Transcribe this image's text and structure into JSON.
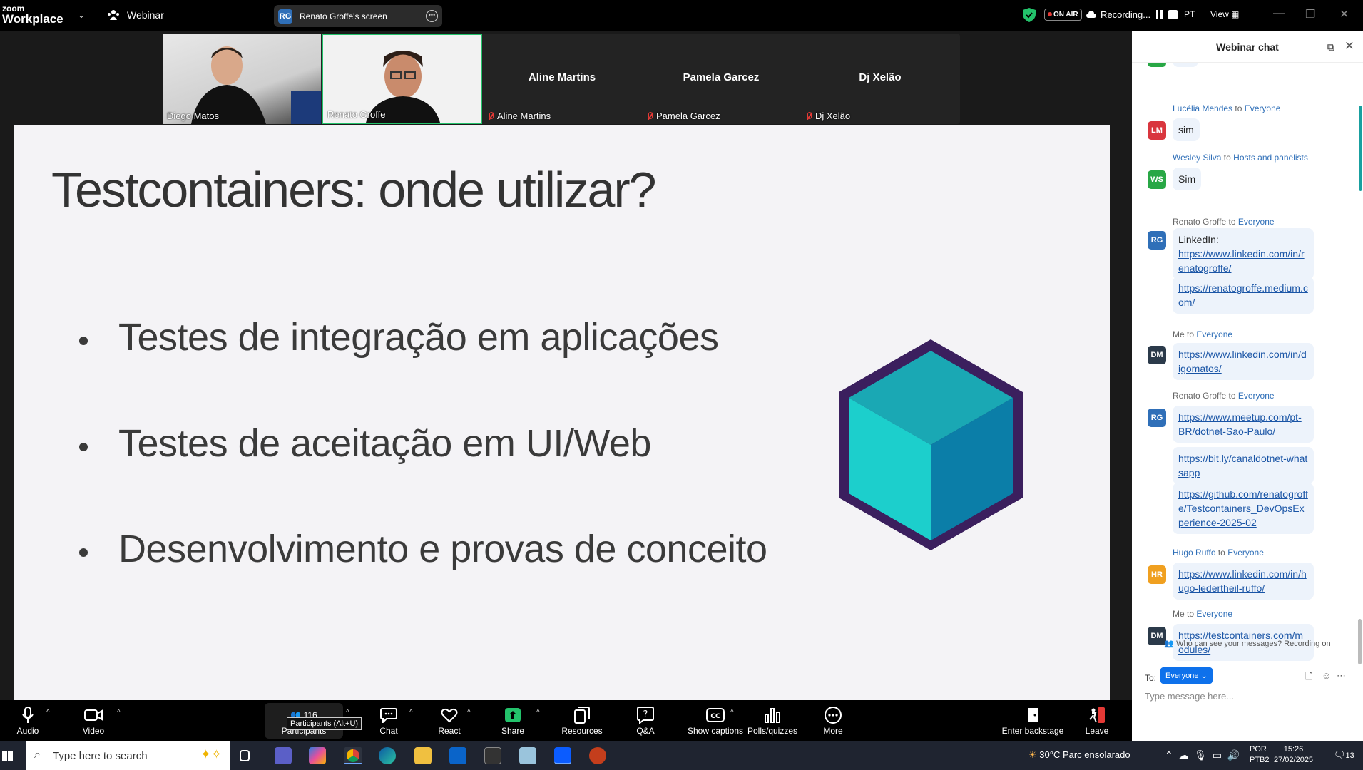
{
  "app": {
    "logo_small": "zoom",
    "logo_big": "Workplace",
    "mode": "Webinar"
  },
  "screen_share": {
    "badge": "RG",
    "label": "Renato Groffe's screen"
  },
  "top_right": {
    "onair": "ON AIR",
    "recording": "Recording...",
    "lang": "PT",
    "view": "View"
  },
  "participants": [
    {
      "name": "Diego Matos"
    },
    {
      "name": "Renato Groffe"
    },
    {
      "name": "Aline Martins"
    },
    {
      "name": "Pamela Garcez"
    },
    {
      "name": "Dj Xelão"
    }
  ],
  "slide": {
    "title": "Testcontainers: onde utilizar?",
    "bullets": [
      "Testes de integração em aplicações",
      "Testes de aceitação em UI/Web",
      "Desenvolvimento e provas de conceito"
    ]
  },
  "chat": {
    "title": "Webinar chat",
    "messages": [
      {
        "sender": "Lucélia Mendes",
        "to": "Everyone",
        "initials": "LM",
        "color": "#d9363e",
        "texts": [
          "sim"
        ]
      },
      {
        "sender": "Wesley Silva",
        "to": "Hosts and panelists",
        "initials": "WS",
        "color": "#28a745",
        "texts": [
          "Sim"
        ]
      },
      {
        "sender": "Renato Groffe",
        "to": "Everyone",
        "initials": "RG",
        "color": "#2f6fb8",
        "lead": "LinkedIn:",
        "texts": [
          "https://www.linkedin.com/in/renatogroffe/",
          "https://renatogroffe.medium.com/"
        ]
      },
      {
        "sender": "Me",
        "to": "Everyone",
        "initials": "DM",
        "color": "#2b3a4a",
        "texts": [
          "https://www.linkedin.com/in/digomatos/"
        ]
      },
      {
        "sender": "Renato Groffe",
        "to": "Everyone",
        "initials": "RG",
        "color": "#2f6fb8",
        "texts": [
          "https://www.meetup.com/pt-BR/dotnet-Sao-Paulo/",
          "https://bit.ly/canaldotnet-whatsapp",
          "https://github.com/renatogroffe/Testcontainers_DevOpsExperience-2025-02"
        ]
      },
      {
        "sender": "Hugo Ruffo",
        "to": "Everyone",
        "initials": "HR",
        "color": "#f0a020",
        "texts": [
          "https://www.linkedin.com/in/hugo-ledertheil-ruffo/"
        ]
      },
      {
        "sender": "Me",
        "to": "Everyone",
        "initials": "DM",
        "color": "#2b3a4a",
        "texts": [
          "https://testcontainers.com/modules/"
        ]
      }
    ],
    "who_sees": "Who can see your messages? Recording on",
    "to_label": "To:",
    "to_value": "Everyone",
    "placeholder": "Type message here..."
  },
  "toolbar": {
    "audio": "Audio",
    "video": "Video",
    "participants": "Participants",
    "participant_count": "116",
    "tooltip": "Participants (Alt+U)",
    "chat": "Chat",
    "react": "React",
    "share": "Share",
    "resources": "Resources",
    "qa": "Q&A",
    "captions": "Show captions",
    "polls": "Polls/quizzes",
    "more": "More",
    "backstage": "Enter backstage",
    "leave": "Leave"
  },
  "taskbar": {
    "search_placeholder": "Type here to search",
    "weather": "30°C  Parc ensolarado",
    "lang1": "POR",
    "lang2": "PTB2",
    "time": "15:26",
    "date": "27/02/2025",
    "notif": "13"
  }
}
